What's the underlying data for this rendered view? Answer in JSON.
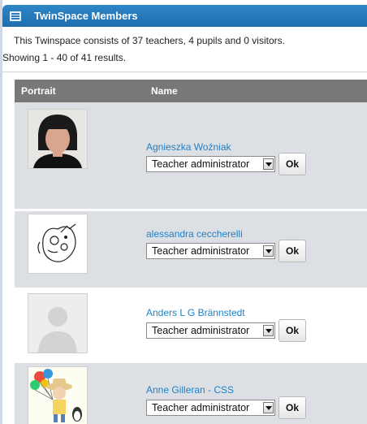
{
  "panel": {
    "title": "TwinSpace Members"
  },
  "summary": {
    "text": "This Twinspace consists of 37 teachers, 4 pupils and 0 visitors.",
    "showing": "Showing 1 - 40 of 41 results."
  },
  "table": {
    "headers": {
      "portrait": "Portrait",
      "name": "Name"
    },
    "ok_label": "Ok",
    "members": [
      {
        "name": "Agnieszka Woźniak",
        "role": "Teacher administrator",
        "portrait_icon": "photo-portrait"
      },
      {
        "name": "alessandra ceccherelli",
        "role": "Teacher administrator",
        "portrait_icon": "doodle-drawing"
      },
      {
        "name": "Anders L G Brännstedt",
        "role": "Teacher administrator",
        "portrait_icon": "default-avatar"
      },
      {
        "name": "Anne Gilleran - CSS",
        "role": "Teacher administrator",
        "portrait_icon": "cartoon-avatar-balloons"
      }
    ]
  }
}
